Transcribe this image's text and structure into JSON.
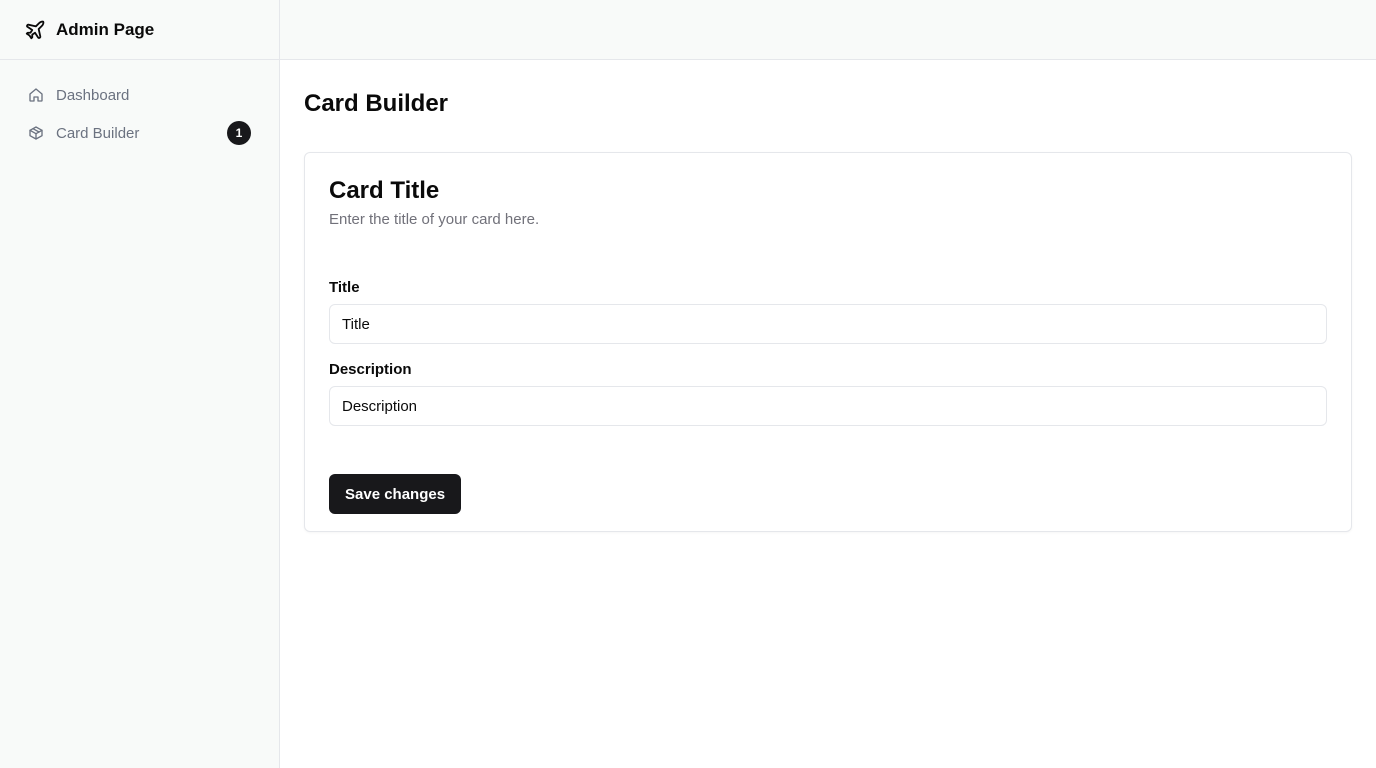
{
  "brand": {
    "title": "Admin Page",
    "icon": "plane-icon"
  },
  "sidebar": {
    "items": [
      {
        "label": "Dashboard",
        "icon": "home-icon"
      },
      {
        "label": "Card Builder",
        "icon": "package-icon",
        "badge": "1"
      }
    ]
  },
  "page": {
    "title": "Card Builder"
  },
  "card": {
    "title": "Card Title",
    "description": "Enter the title of your card here.",
    "fields": [
      {
        "label": "Title",
        "value": "Title"
      },
      {
        "label": "Description",
        "value": "Description"
      }
    ],
    "save_label": "Save changes"
  },
  "colors": {
    "sidebar_bg": "#f8faf9",
    "border": "#e5e7eb",
    "primary": "#18181b",
    "muted_text": "#6b7280"
  }
}
